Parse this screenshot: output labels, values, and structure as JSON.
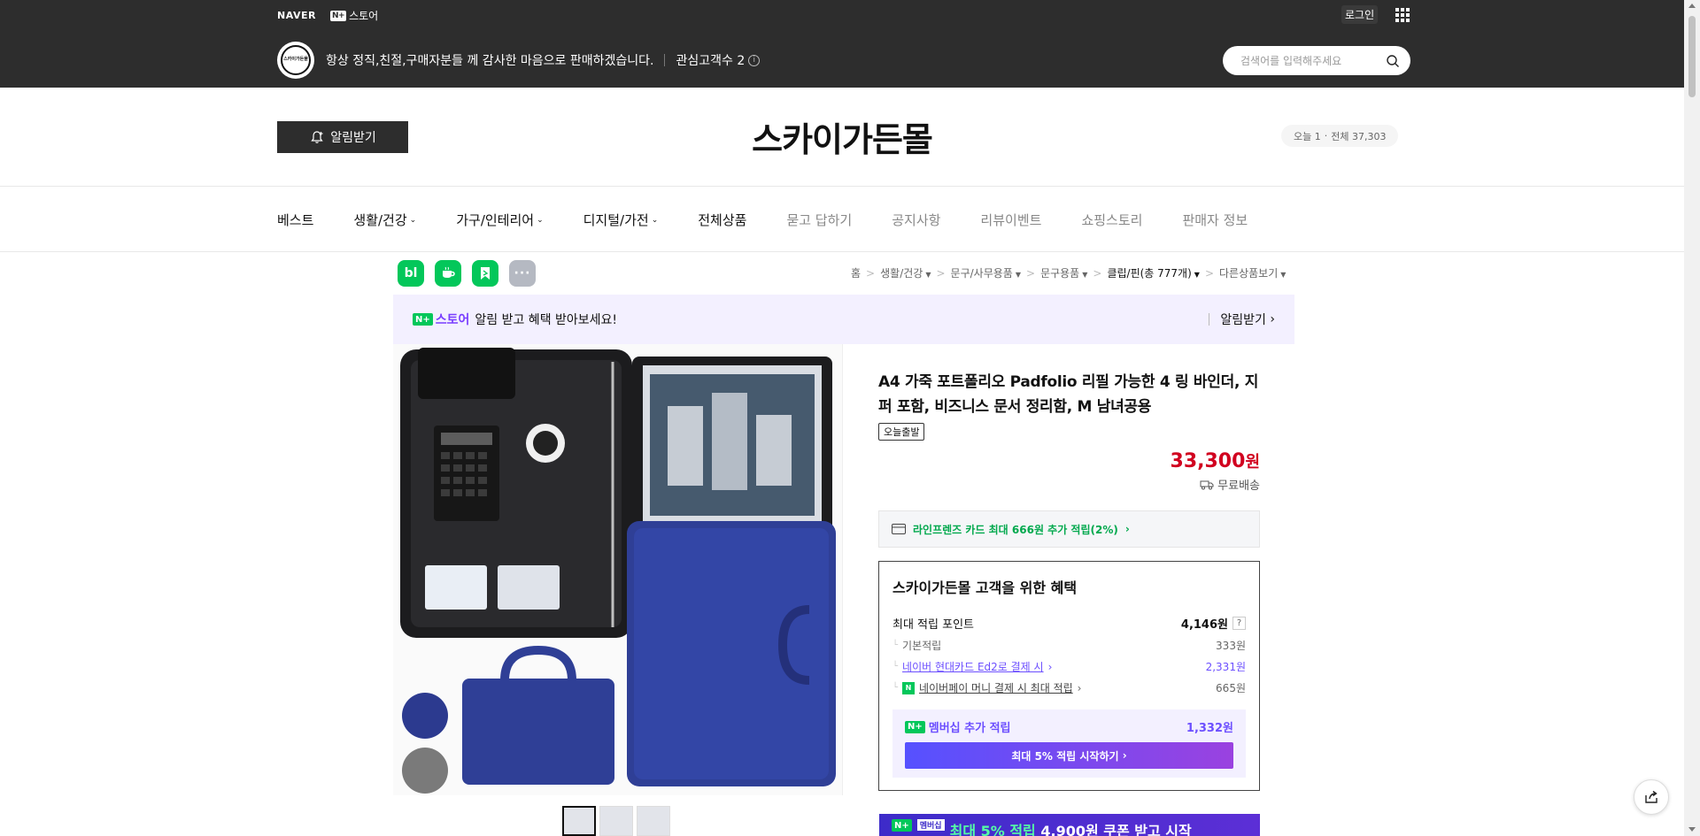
{
  "gnb": {
    "naver_logo": "NAVER",
    "nstore_mark": "N+",
    "nstore_label": "스토어",
    "login": "로그인",
    "apps_icon": "grid-icon"
  },
  "store": {
    "avatar_text": "스카이가든몰",
    "description": "항상 정직,친절,구매자분들 께 감사한 마음으로 판매하겠습니다.",
    "fav_label": "관심고객수 2",
    "search_placeholder": "검색어를 입력해주세요",
    "alarm_button": "알림받기",
    "title": "스카이가든몰",
    "visitor_today": "오늘 1",
    "visitor_total": "전체 37,303"
  },
  "nav": {
    "items": [
      {
        "label": "베스트",
        "dropdown": false,
        "muted": false
      },
      {
        "label": "생활/건강",
        "dropdown": true,
        "muted": false
      },
      {
        "label": "가구/인테리어",
        "dropdown": true,
        "muted": false
      },
      {
        "label": "디지털/가전",
        "dropdown": true,
        "muted": false
      },
      {
        "label": "전체상품",
        "dropdown": false,
        "muted": false
      },
      {
        "label": "묻고 답하기",
        "dropdown": false,
        "muted": true
      },
      {
        "label": "공지사항",
        "dropdown": false,
        "muted": true
      },
      {
        "label": "리뷰이벤트",
        "dropdown": false,
        "muted": true
      },
      {
        "label": "쇼핑스토리",
        "dropdown": false,
        "muted": true
      },
      {
        "label": "판매자 정보",
        "dropdown": false,
        "muted": true
      }
    ]
  },
  "share": {
    "blog": "bl",
    "cafe": "cafe-icon",
    "band": "band-icon",
    "more": "···"
  },
  "breadcrumb": {
    "items": [
      "홈",
      "생활/건강",
      "문구/사무용품",
      "문구용품",
      "클립/핀(총 777개)",
      "다른상품보기"
    ]
  },
  "promo": {
    "brand_mark": "N+",
    "brand": "스토어",
    "text": "알림 받고 혜택 받아보세요!",
    "action": "알림받기"
  },
  "product": {
    "title": "A4 가죽 포트폴리오 Padfolio 리필 가능한 4 링 바인더, 지퍼 포함, 비즈니스 문서 정리함, M 남녀공용",
    "badge": "오늘출발",
    "price": "33,300",
    "price_unit": "원",
    "shipping": "무료배송",
    "card_benefit": "라인프렌즈 카드 최대 666원 추가 적립(2%)"
  },
  "benefits": {
    "title": "스카이가든몰 고객을 위한 혜택",
    "max_points_label": "최대 적립 포인트",
    "max_points_value": "4,146원",
    "help_icon": "?",
    "sub": [
      {
        "label": "기본적립",
        "value": "333원",
        "style": "plain"
      },
      {
        "label": "네이버 현대카드 Ed2로 결제 시",
        "value": "2,331원",
        "style": "link"
      },
      {
        "label": "네이버페이 머니 결제 시 최대 적립",
        "value": "665원",
        "style": "npay"
      }
    ],
    "member_label": "멤버십 추가 적립",
    "member_value": "1,332원",
    "start_button": "최대 5% 적립 시작하기"
  },
  "coupon": {
    "tag": "멤버십",
    "highlight": "최대 5% 적립",
    "rest": "4,900원 쿠폰 받고 시작"
  },
  "colors": {
    "dark_bar": "#2d2d2d",
    "naver_green": "#03c75a",
    "price_red": "#d1001f",
    "membership_purple": "#6c4fff"
  }
}
